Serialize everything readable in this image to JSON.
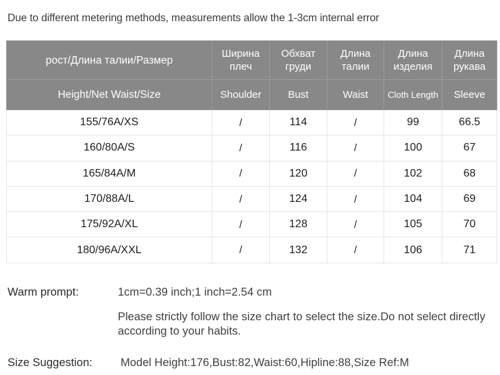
{
  "notice": "Due to different metering methods, measurements allow the 1-3cm internal error",
  "table": {
    "header_ru": [
      "рост/Длина  талии/Размер",
      "Ширина плеч",
      "Обхват груди",
      "Длина талии",
      "Длина изделия",
      "Длина рукава"
    ],
    "header_en": [
      "Height/Net  Waist/Size",
      "Shoulder",
      "Bust",
      "Waist",
      "Cloth Length",
      "Sleeve"
    ],
    "rows": [
      [
        "155/76A/XS",
        "/",
        "114",
        "/",
        "99",
        "66.5"
      ],
      [
        "160/80A/S",
        "/",
        "116",
        "/",
        "100",
        "67"
      ],
      [
        "165/84A/M",
        "/",
        "120",
        "/",
        "102",
        "68"
      ],
      [
        "170/88A/L",
        "/",
        "124",
        "/",
        "104",
        "69"
      ],
      [
        "175/92A/XL",
        "/",
        "128",
        "/",
        "105",
        "70"
      ],
      [
        "180/96A/XXL",
        "/",
        "132",
        "/",
        "106",
        "71"
      ]
    ]
  },
  "footer": {
    "warm_prompt_label": "Warm prompt:",
    "warm_prompt_value": "1cm=0.39 inch;1 inch=2.54 cm",
    "warm_prompt_note": "Please strictly follow the size chart  to select the size.Do not select directly according to your habits.",
    "size_suggestion_label": "Size Suggestion:",
    "size_suggestion_value": "Model Height:176,Bust:82,Waist:60,Hipline:88,Size Ref:M"
  },
  "colors": {
    "header_bg": "#888888",
    "header_text": "#ffffff",
    "body_text": "#1d1d1d",
    "grid_line": "#e6e6e6"
  }
}
